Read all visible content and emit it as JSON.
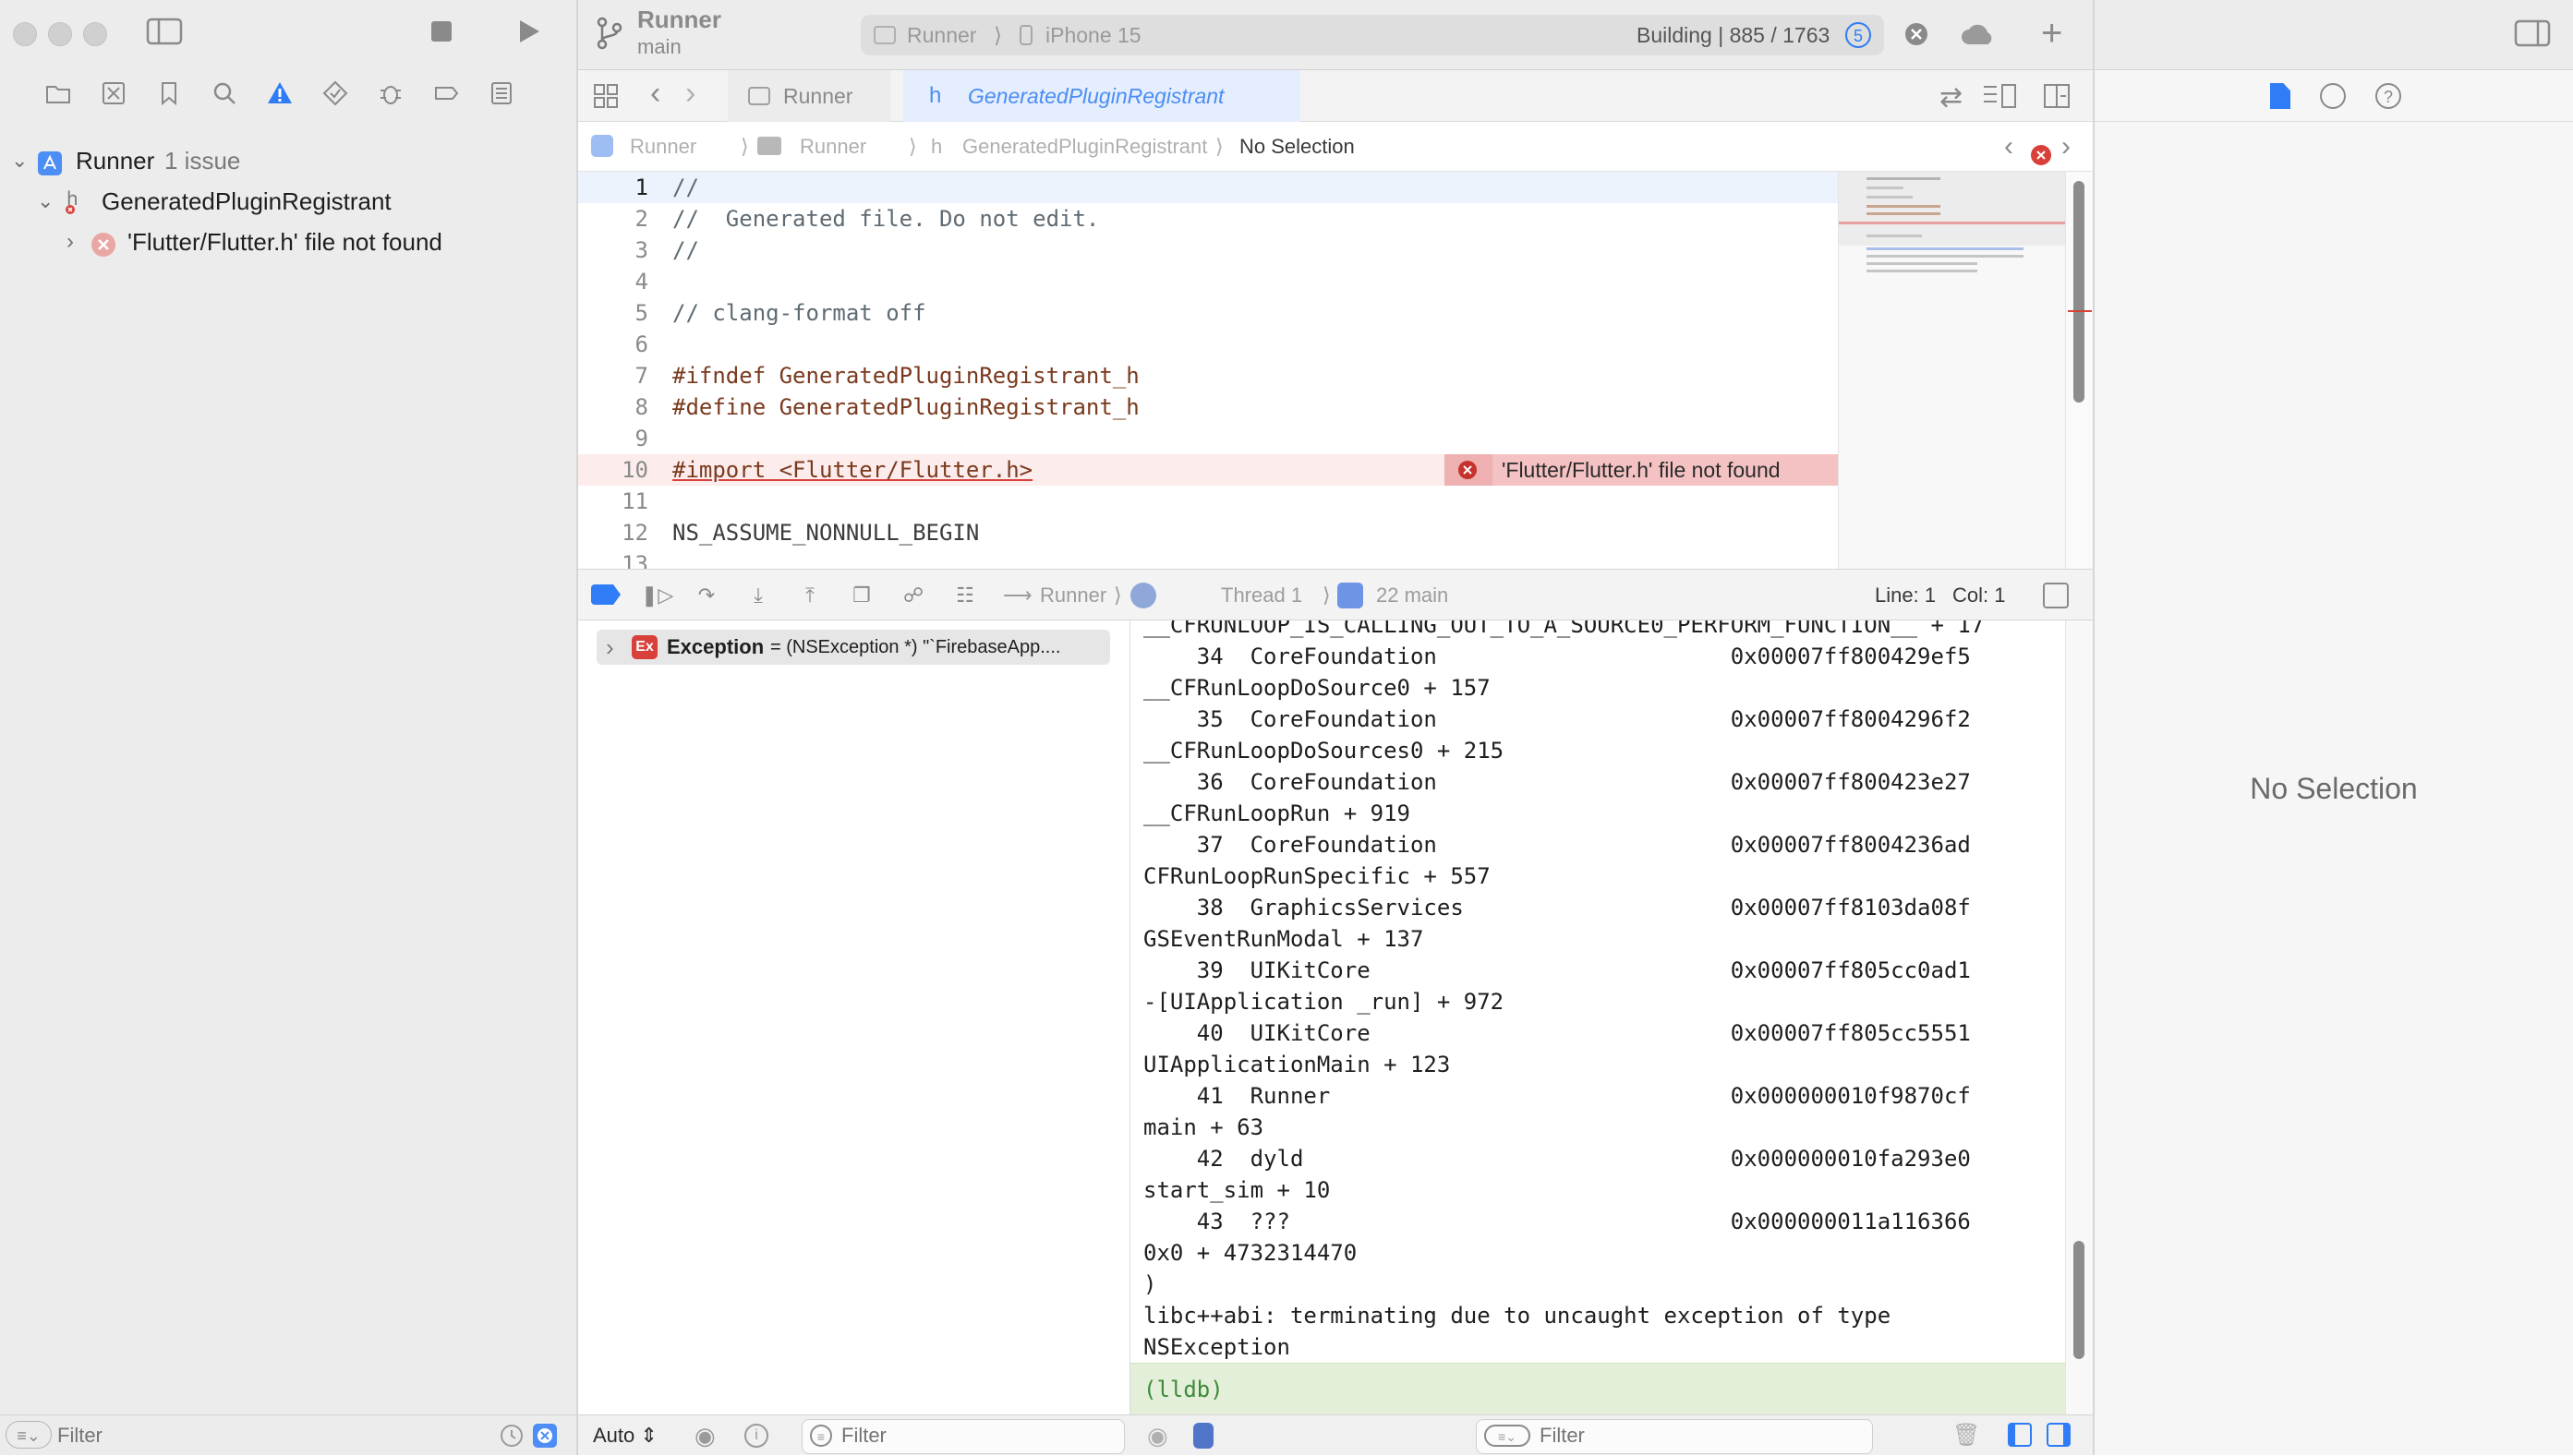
{
  "toolbar": {
    "scheme_project": "Runner",
    "scheme_branch": "main",
    "destination_scheme": "Runner",
    "destination_device": "iPhone 15",
    "status": "Building | 885 / 1763",
    "task_count": "5"
  },
  "tabs": [
    {
      "label": "Runner"
    },
    {
      "label": "GeneratedPluginRegistrant"
    }
  ],
  "jumpbar": {
    "crumbs": [
      "Runner",
      "Runner",
      "GeneratedPluginRegistrant",
      "No Selection"
    ]
  },
  "navigator": {
    "project": "Runner",
    "issue_count": "1 issue",
    "file": "GeneratedPluginRegistrant",
    "error": "'Flutter/Flutter.h' file not found",
    "filter_placeholder": "Filter"
  },
  "editor": {
    "lines": [
      {
        "n": "1",
        "text": "//"
      },
      {
        "n": "2",
        "text": "//  Generated file. Do not edit."
      },
      {
        "n": "3",
        "text": "//"
      },
      {
        "n": "4",
        "text": ""
      },
      {
        "n": "5",
        "text": "// clang-format off"
      },
      {
        "n": "6",
        "text": ""
      },
      {
        "n": "7",
        "text": "#ifndef GeneratedPluginRegistrant_h"
      },
      {
        "n": "8",
        "text": "#define GeneratedPluginRegistrant_h"
      },
      {
        "n": "9",
        "text": ""
      },
      {
        "n": "10",
        "text": "#import <Flutter/Flutter.h>"
      },
      {
        "n": "11",
        "text": ""
      },
      {
        "n": "12",
        "text": "NS_ASSUME_NONNULL_BEGIN"
      },
      {
        "n": "13",
        "text": ""
      }
    ],
    "error_message": "'Flutter/Flutter.h' file not found"
  },
  "debugbar": {
    "crumbs": [
      "Runner",
      "Thread 1",
      "22 main"
    ],
    "line": "Line: 1",
    "col": "Col: 1"
  },
  "variables": {
    "exception_name": "Exception",
    "exception_value": "= (NSException *) \"`FirebaseApp...."
  },
  "console": {
    "lines": [
      "__CFRUNLOOP_IS_CALLING_OUT_TO_A_SOURCE0_PERFORM_FUNCTION__ + 17",
      "    34  CoreFoundation                      0x00007ff800429ef5",
      "__CFRunLoopDoSource0 + 157",
      "    35  CoreFoundation                      0x00007ff8004296f2",
      "__CFRunLoopDoSources0 + 215",
      "    36  CoreFoundation                      0x00007ff800423e27",
      "__CFRunLoopRun + 919",
      "    37  CoreFoundation                      0x00007ff8004236ad",
      "CFRunLoopRunSpecific + 557",
      "    38  GraphicsServices                    0x00007ff8103da08f",
      "GSEventRunModal + 137",
      "    39  UIKitCore                           0x00007ff805cc0ad1",
      "-[UIApplication _run] + 972",
      "    40  UIKitCore                           0x00007ff805cc5551",
      "UIApplicationMain + 123",
      "    41  Runner                              0x000000010f9870cf",
      "main + 63",
      "    42  dyld                                0x000000010fa293e0",
      "start_sim + 10",
      "    43  ???                                 0x000000011a116366",
      "0x0 + 4732314470",
      ")",
      "libc++abi: terminating due to uncaught exception of type",
      "NSException"
    ],
    "prompt": "(lldb)"
  },
  "bottombar": {
    "auto_label": "Auto",
    "vars_filter_placeholder": "Filter",
    "console_filter_placeholder": "Filter"
  },
  "inspector": {
    "empty_text": "No Selection"
  },
  "colors": {
    "accent": "#2f7cf6",
    "error": "#d9403a",
    "error_line_bg": "#fdecec",
    "error_banner_bg": "#f4c2c2",
    "lldb_bg": "#e3efd9"
  }
}
